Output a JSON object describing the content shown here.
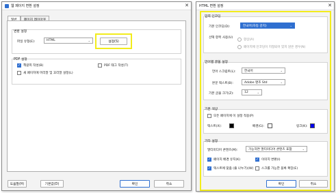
{
  "left_dialog": {
    "title": "웹 페이지 변환 설정",
    "tabs": [
      {
        "label": "일반"
      },
      {
        "label": "페이지 레이아웃"
      }
    ],
    "conversion": {
      "group_title": "변환 설정",
      "file_type_label": "파일 유형(E):",
      "file_type_value": "HTML",
      "settings_button": "설정(S)"
    },
    "pdf": {
      "group_title": "PDF 설정",
      "options": [
        {
          "label": "책갈피 작성(B)",
          "checked": true
        },
        {
          "label": "PDF 태그 작성(T)",
          "checked": false
        },
        {
          "label": "새 페이지에 머리말 및 꼬리말 설정(L)",
          "checked": false
        }
      ]
    },
    "buttons": {
      "help": "도움말(H)",
      "default": "기본값(D)",
      "ok": "확인",
      "cancel": "취소"
    }
  },
  "right_dialog": {
    "title": "HTML 변환 설정",
    "input_encoding": {
      "group_title": "입력 인코딩",
      "default_encoding_label": "기본 인코딩(D):",
      "default_encoding_value": "한국어(자동 감지)",
      "auto_select_label": "선택 항목 사용(U)",
      "radio1": "항상(A)",
      "radio2": "페이지에 인코딩이 지정되어 있지 않은 경우(N)"
    },
    "language_font": {
      "group_title": "언어별 글꼴 설정",
      "script_label": "언어 스크립트(L):",
      "script_value": "한국어",
      "body_font_label": "본문 텍스트(B):",
      "body_font_value": "Adobe 명조 Std",
      "base_size_label": "기본 글꼴 크기(Z):",
      "base_size_value": "12"
    },
    "colors": {
      "group_title": "기본 색상",
      "apply_all_label": "모든 페이지에 이 설정 적용(P)",
      "text_label": "텍스트(X):",
      "text_color": "#000000",
      "background_label": "배경(G):",
      "background_color": "#ffffff",
      "link_label": "링크(K):",
      "link_color": "#0000ee"
    },
    "other": {
      "group_title": "기타 설정",
      "multimedia_label": "멀티미디어 콘텐츠(M):",
      "multimedia_value": "가능하면 멀티미디어 콘텐츠 포함",
      "options": [
        {
          "label": "페이지 배경 유지(K)",
          "checked": true
        },
        {
          "label": "이미지 변환(I)",
          "checked": true
        },
        {
          "label": "텍스트에 맞춤 (줄 나누기)(W)",
          "checked": true
        },
        {
          "label": "스크롤 가능한 블록 확장(E)",
          "checked": false
        }
      ]
    },
    "buttons": {
      "ok": "확인",
      "cancel": "취소"
    }
  },
  "colors": {
    "accent": "#2f6fd0",
    "highlight": "#f2ec1b"
  }
}
